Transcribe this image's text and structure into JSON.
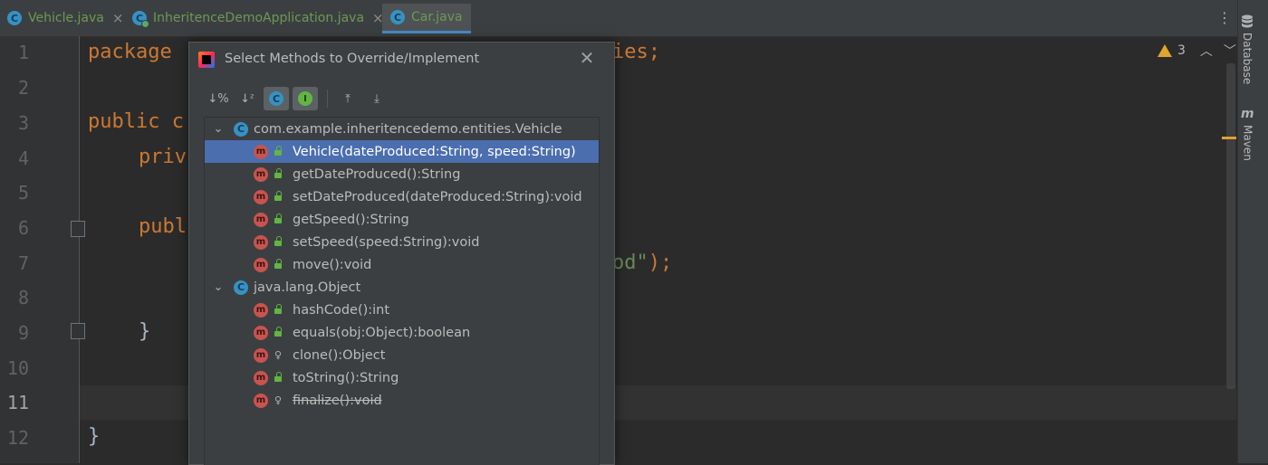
{
  "tabs": [
    {
      "label": "Vehicle.java",
      "icon": "class-icon"
    },
    {
      "label": "InheritenceDemoApplication.java",
      "icon": "run-class-icon"
    },
    {
      "label": "Car.java",
      "icon": "class-icon",
      "active": true
    }
  ],
  "right_tools": [
    {
      "label": "Database",
      "icon": "database-icon"
    },
    {
      "label": "Maven",
      "icon": "maven-icon",
      "glyph": "m"
    }
  ],
  "inspection": {
    "count": "3"
  },
  "editor": {
    "line_numbers": [
      "1",
      "2",
      "3",
      "4",
      "5",
      "6",
      "7",
      "8",
      "9",
      "10",
      "11",
      "12"
    ],
    "current_line": "11",
    "lines": {
      "l1_kw": "package",
      "l1_tail": "ies;",
      "l3_kw": "public",
      "l3_tail": "c",
      "l4": "priv",
      "l6": "publ",
      "l7_str": "od\"",
      "l7_tail": ");",
      "l9": "}",
      "l12": "}"
    }
  },
  "dialog": {
    "title": "Select Methods to Override/Implement",
    "toolbar": [
      {
        "name": "sort-by-visibility-button",
        "glyph": "↓%"
      },
      {
        "name": "sort-alphabetically-button",
        "glyph": "↓ᶻ"
      },
      {
        "name": "show-classes-button",
        "glyph": "C",
        "active": true
      },
      {
        "name": "show-interfaces-button",
        "glyph": "I",
        "active": true
      },
      {
        "name": "expand-all-button",
        "glyph": "⤒"
      },
      {
        "name": "collapse-all-button",
        "glyph": "⤓"
      }
    ],
    "groups": [
      {
        "class": "com.example.inheritencedemo.entities.Vehicle",
        "methods": [
          {
            "label": "Vehicle(dateProduced:String, speed:String)",
            "visibility": "public",
            "selected": true
          },
          {
            "label": "getDateProduced():String",
            "visibility": "public"
          },
          {
            "label": "setDateProduced(dateProduced:String):void",
            "visibility": "public"
          },
          {
            "label": "getSpeed():String",
            "visibility": "public"
          },
          {
            "label": "setSpeed(speed:String):void",
            "visibility": "public"
          },
          {
            "label": "move():void",
            "visibility": "public"
          }
        ]
      },
      {
        "class": "java.lang.Object",
        "methods": [
          {
            "label": "hashCode():int",
            "visibility": "public"
          },
          {
            "label": "equals(obj:Object):boolean",
            "visibility": "public"
          },
          {
            "label": "clone():Object",
            "visibility": "protected"
          },
          {
            "label": "toString():String",
            "visibility": "public"
          },
          {
            "label": "finalize():void",
            "visibility": "protected",
            "deprecated": true
          }
        ]
      }
    ]
  }
}
